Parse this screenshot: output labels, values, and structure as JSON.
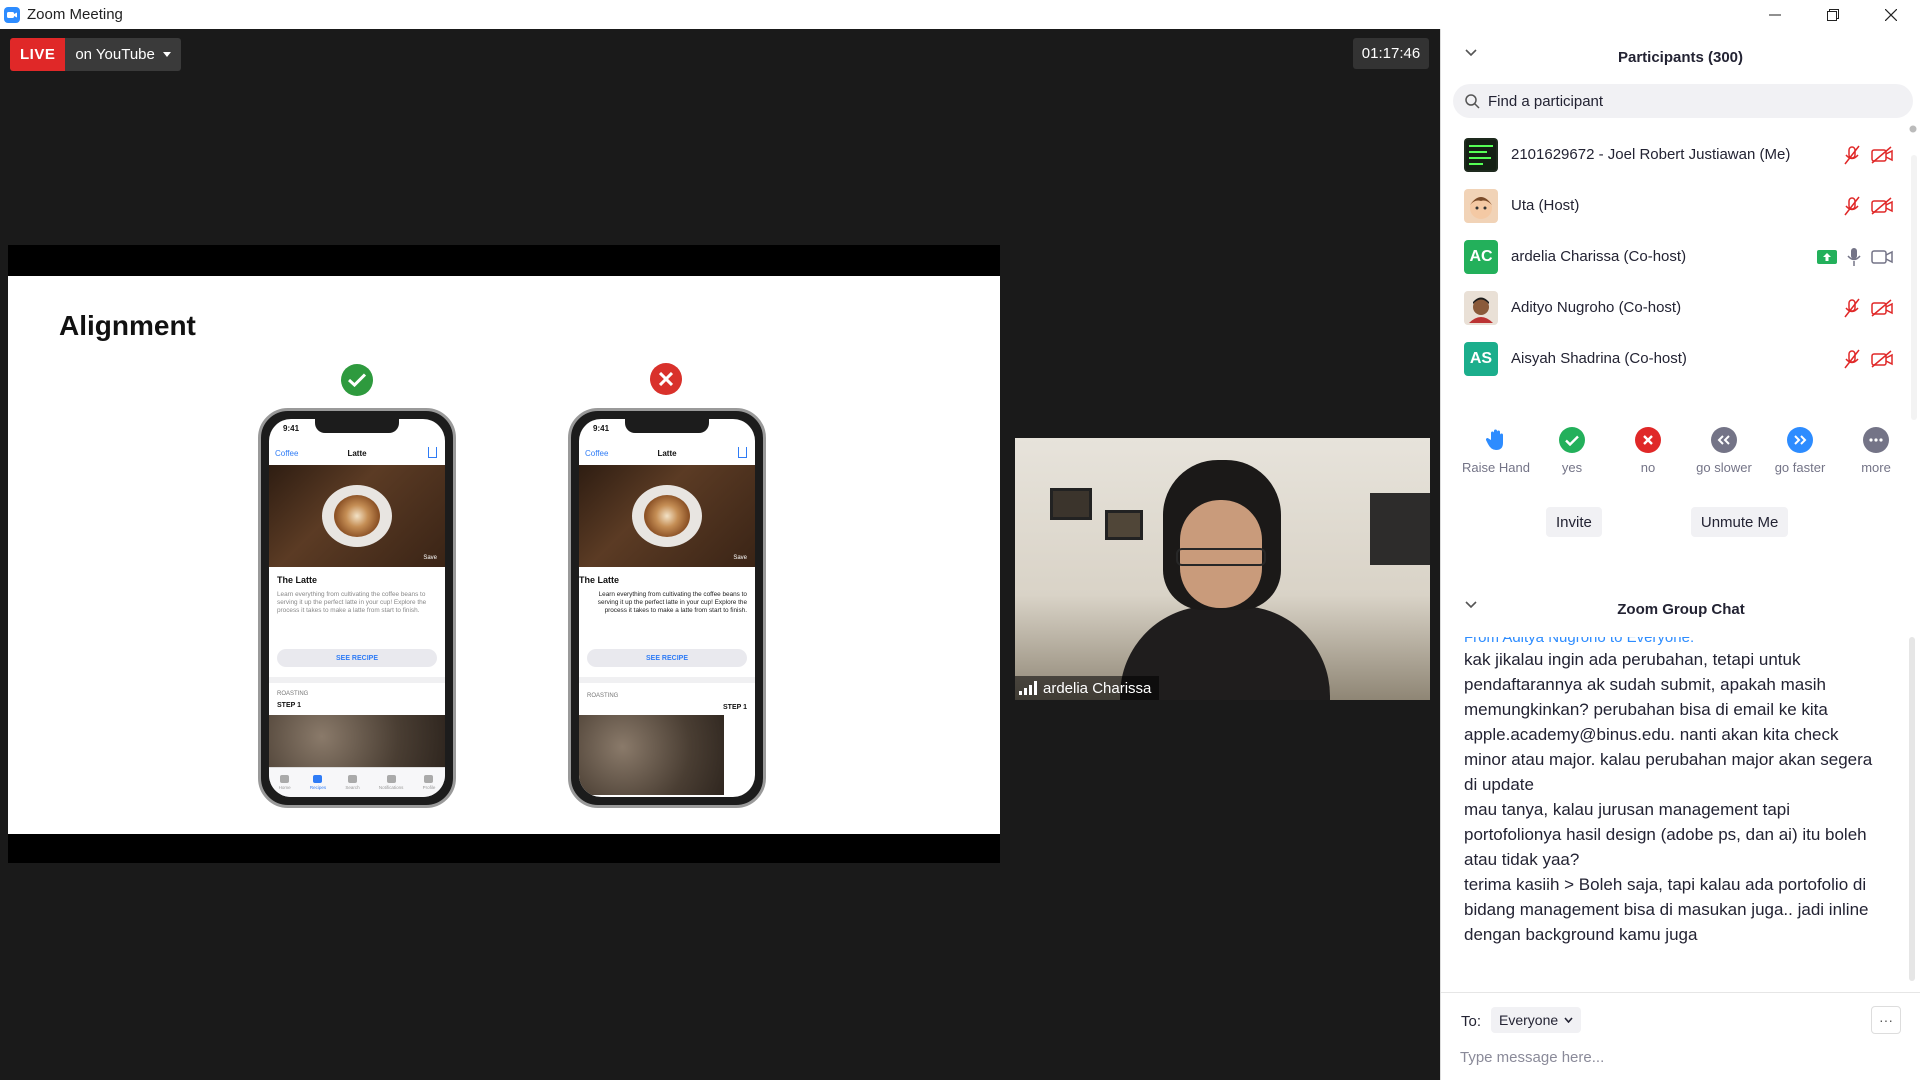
{
  "window": {
    "title": "Zoom Meeting"
  },
  "stream": {
    "live_label": "LIVE",
    "target": "on YouTube",
    "timer": "01:17:46"
  },
  "slide": {
    "title": "Alignment",
    "phone": {
      "time": "9:41",
      "back": "Coffee",
      "nav_title": "Latte",
      "save": "Save",
      "recipe_title": "The Latte",
      "description": "Learn everything from cultivating the coffee beans to serving it up the perfect latte in your cup! Explore the process it takes to make a latte from start to finish.",
      "button": "SEE RECIPE",
      "section": "ROASTING",
      "step": "STEP 1",
      "tabs": [
        "Home",
        "Recipes",
        "Search",
        "Notifications",
        "Profile"
      ]
    }
  },
  "video": {
    "name": "ardelia Charissa"
  },
  "participants": {
    "header": "Participants (300)",
    "search_placeholder": "Find a participant",
    "list": [
      {
        "name": "2101629672 - Joel Robert Justiawan (Me)",
        "initials": "",
        "color": "#2a3a2a"
      },
      {
        "name": "Uta (Host)",
        "initials": "",
        "color": "#c8a07a"
      },
      {
        "name": "ardelia Charissa (Co-host)",
        "initials": "AC",
        "color": "#23B05B"
      },
      {
        "name": "Adityo Nugroho (Co-host)",
        "initials": "",
        "color": "#6b4a32"
      },
      {
        "name": "Aisyah Shadrina (Co-host)",
        "initials": "AS",
        "color": "#1BAE8C"
      }
    ]
  },
  "reactions": [
    {
      "label": "Raise Hand",
      "color": "#2D8CFF"
    },
    {
      "label": "yes",
      "color": "#23B05B"
    },
    {
      "label": "no",
      "color": "#E02828"
    },
    {
      "label": "go slower",
      "color": "#747487"
    },
    {
      "label": "go faster",
      "color": "#2D8CFF"
    },
    {
      "label": "more",
      "color": "#747487"
    }
  ],
  "actions": {
    "invite": "Invite",
    "unmute": "Unmute Me"
  },
  "chat": {
    "header": "Zoom Group Chat",
    "cut_line": "From Aditya Nugroho to Everyone:",
    "messages": [
      "kak jikalau ingin ada perubahan, tetapi untuk pendaftarannya ak sudah submit, apakah masih memungkinkan? perubahan bisa di email ke kita apple.academy@binus.edu. nanti akan kita check minor atau major. kalau perubahan major akan segera di update",
      "mau tanya, kalau jurusan management tapi portofolionya hasil design (adobe ps, dan ai) itu boleh atau tidak yaa?",
      "terima kasiih > Boleh saja, tapi kalau ada portofolio di bidang management bisa di masukan juga.. jadi inline dengan background kamu juga"
    ],
    "to_label": "To:",
    "to_value": "Everyone",
    "more": "···",
    "input_placeholder": "Type message here..."
  },
  "colors": {
    "zoom_blue": "#2D8CFF",
    "live_red": "#E02828",
    "stage_bg": "#1a1a1a"
  }
}
